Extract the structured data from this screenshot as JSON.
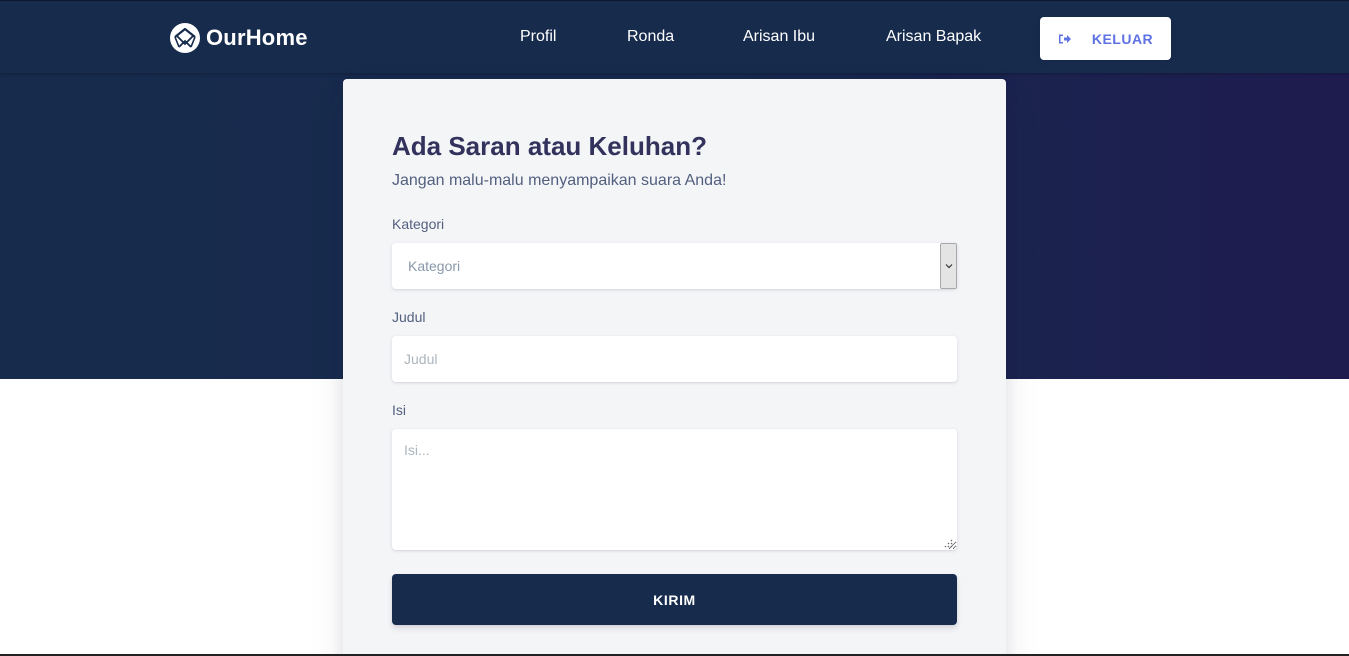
{
  "brand": {
    "name": "OurHome",
    "logo_icon": "house-globe-logo-icon"
  },
  "nav": {
    "items": [
      {
        "label": "Profil"
      },
      {
        "label": "Ronda"
      },
      {
        "label": "Arisan Ibu"
      },
      {
        "label": "Arisan Bapak"
      }
    ],
    "logout": {
      "label": "KELUAR",
      "icon": "sign-out-icon"
    }
  },
  "form": {
    "title": "Ada Saran atau Keluhan?",
    "subtitle": "Jangan malu-malu menyampaikan suara Anda!",
    "kategori": {
      "label": "Kategori",
      "selected": "Kategori",
      "icon": "chevron-down-icon"
    },
    "judul": {
      "label": "Judul",
      "placeholder": "Judul",
      "value": ""
    },
    "isi": {
      "label": "Isi",
      "placeholder": "Isi...",
      "value": ""
    },
    "submit_label": "KIRIM"
  },
  "colors": {
    "primary_dark": "#172b4d",
    "accent": "#5e72e4",
    "card_bg": "#f4f5f7",
    "text_heading": "#32325d",
    "text_muted": "#525f7f"
  }
}
